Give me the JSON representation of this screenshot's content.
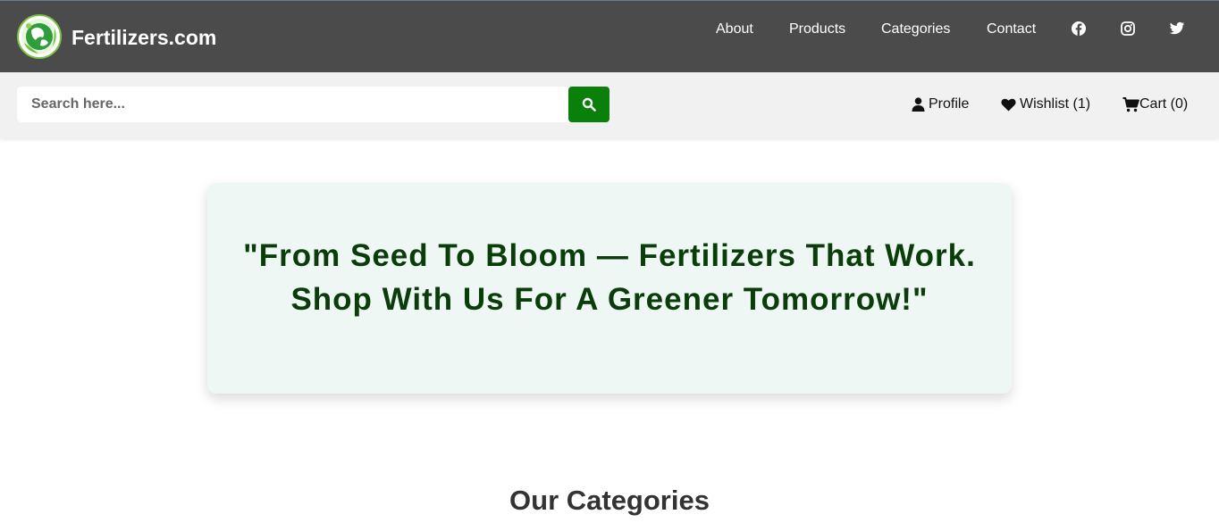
{
  "header": {
    "brand": "Fertilizers.com",
    "logo_icon": "globe-leaf-logo",
    "nav": [
      {
        "label": "About"
      },
      {
        "label": "Products"
      },
      {
        "label": "Categories"
      },
      {
        "label": "Contact"
      }
    ],
    "social_icons": [
      "facebook-icon",
      "instagram-icon",
      "twitter-icon"
    ]
  },
  "toolbar": {
    "search_placeholder": "Search here...",
    "search_icon": "search-icon",
    "profile_label": "Profile",
    "wishlist_label": "Wishlist (1)",
    "cart_label": "Cart (0)"
  },
  "hero": {
    "quote_line1": "\"From Seed To Bloom — Fertilizers That Work.",
    "quote_line2": "Shop With Us For A Greener Tomorrow!\""
  },
  "sections": {
    "categories_title": "Our Categories"
  },
  "colors": {
    "header_bg": "#4b4b4b",
    "toolbar_bg": "#f1f1f1",
    "accent_green": "#0a7f0a",
    "hero_bg": "#eef7f3",
    "hero_text": "#0b3d0b"
  }
}
